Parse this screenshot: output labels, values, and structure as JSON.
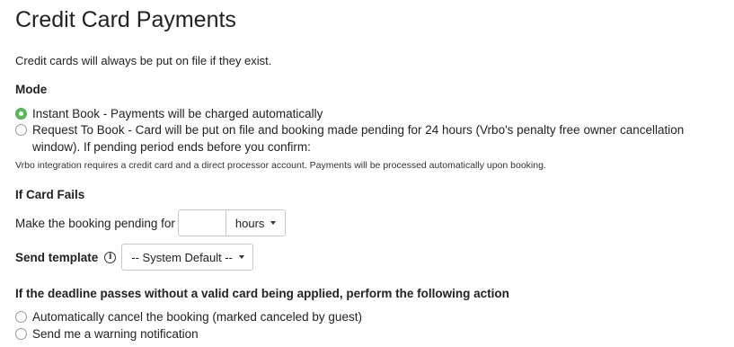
{
  "page": {
    "title": "Credit Card Payments",
    "intro": "Credit cards will always be put on file if they exist."
  },
  "mode": {
    "heading": "Mode",
    "options": [
      {
        "label": "Instant Book - Payments will be charged automatically",
        "checked": true
      },
      {
        "label": "Request To Book - Card will be put on file and booking made pending for 24 hours (Vrbo's penalty free owner cancellation window). If pending period ends before you confirm:",
        "checked": false
      }
    ],
    "note": "Vrbo integration requires a credit card and a direct processor account. Payments will be processed automatically upon booking."
  },
  "card_fails": {
    "heading": "If Card Fails",
    "pending_label": "Make the booking pending for",
    "pending_value": "",
    "unit": "hours",
    "template_label": "Send template",
    "template_value": "-- System Default --"
  },
  "deadline": {
    "heading": "If the deadline passes without a valid card being applied, perform the following action",
    "options": [
      {
        "label": "Automatically cancel the booking (marked canceled by guest)",
        "checked": false
      },
      {
        "label": "Send me a warning notification",
        "checked": false
      }
    ]
  },
  "colors": {
    "radio_checked": "#5cb85c",
    "text": "#222222",
    "border": "#c8c8c8"
  },
  "icons": {
    "info": "info-circle-icon",
    "caret": "caret-down-icon"
  }
}
